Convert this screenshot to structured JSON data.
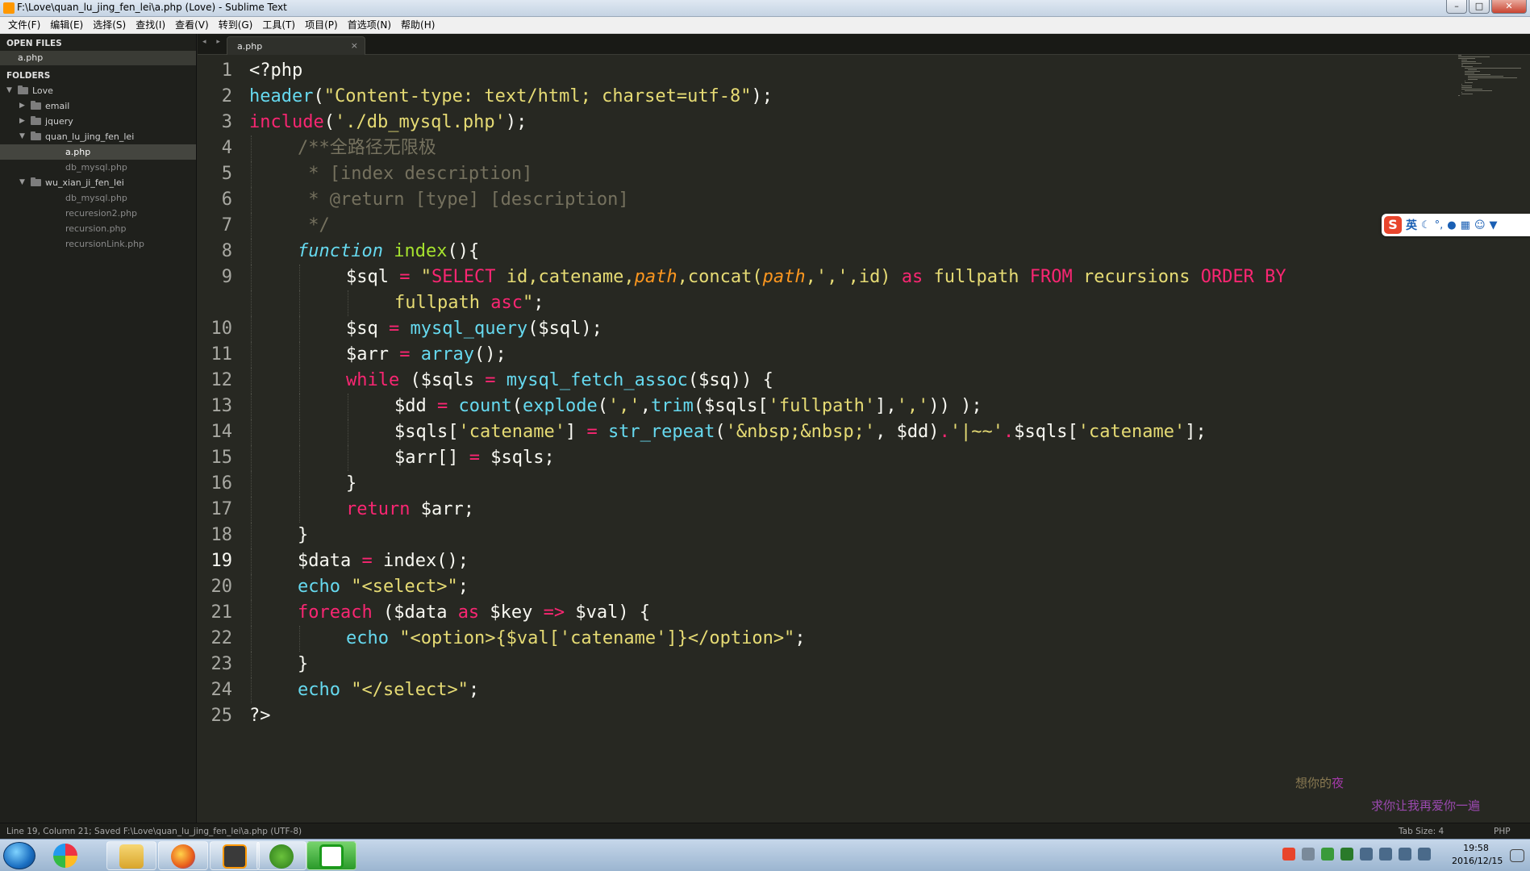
{
  "window": {
    "title": "F:\\Love\\quan_lu_jing_fen_lei\\a.php (Love) - Sublime Text",
    "buttons": [
      "–",
      "□",
      "✕"
    ]
  },
  "menu": [
    "文件(F)",
    "编辑(E)",
    "选择(S)",
    "查找(I)",
    "查看(V)",
    "转到(G)",
    "工具(T)",
    "项目(P)",
    "首选项(N)",
    "帮助(H)"
  ],
  "sidebar": {
    "open_files_title": "OPEN FILES",
    "open_files": [
      "a.php"
    ],
    "folders_title": "FOLDERS",
    "tree": [
      {
        "label": "Love",
        "type": "folder",
        "depth": 0,
        "expanded": true
      },
      {
        "label": "email",
        "type": "folder",
        "depth": 1,
        "expanded": false
      },
      {
        "label": "jquery",
        "type": "folder",
        "depth": 1,
        "expanded": false
      },
      {
        "label": "quan_lu_jing_fen_lei",
        "type": "folder",
        "depth": 1,
        "expanded": true
      },
      {
        "label": "a.php",
        "type": "file",
        "depth": 2,
        "selected": true
      },
      {
        "label": "db_mysql.php",
        "type": "file",
        "depth": 2
      },
      {
        "label": "wu_xian_ji_fen_lei",
        "type": "folder",
        "depth": 1,
        "expanded": true
      },
      {
        "label": "db_mysql.php",
        "type": "file",
        "depth": 2
      },
      {
        "label": "recuresion2.php",
        "type": "file",
        "depth": 2
      },
      {
        "label": "recursion.php",
        "type": "file",
        "depth": 2
      },
      {
        "label": "recursionLink.php",
        "type": "file",
        "depth": 2
      }
    ]
  },
  "tabs": {
    "nav": "◂ ▸",
    "items": [
      {
        "label": "a.php",
        "close": "×"
      }
    ]
  },
  "editor": {
    "current_line": 19,
    "lines": [
      {
        "n": "1",
        "indent": 0,
        "tokens": [
          [
            "<?php",
            ""
          ]
        ]
      },
      {
        "n": "2",
        "indent": 0,
        "tokens": [
          [
            "header",
            "fn"
          ],
          [
            "(",
            ""
          ],
          [
            "\"Content-type: text/html; charset=utf-8\"",
            "st"
          ],
          [
            ");",
            ""
          ]
        ]
      },
      {
        "n": "3",
        "indent": 0,
        "tokens": [
          [
            "include",
            "kw"
          ],
          [
            "(",
            ""
          ],
          [
            "'./db_mysql.php'",
            "st"
          ],
          [
            ");",
            ""
          ]
        ]
      },
      {
        "n": "4",
        "indent": 1,
        "tokens": [
          [
            "/**全路径无限极",
            "cm"
          ]
        ]
      },
      {
        "n": "5",
        "indent": 1,
        "tokens": [
          [
            " * [index description]",
            "cm"
          ]
        ]
      },
      {
        "n": "6",
        "indent": 1,
        "tokens": [
          [
            " * @return [type] [description]",
            "cm"
          ]
        ]
      },
      {
        "n": "7",
        "indent": 1,
        "tokens": [
          [
            " */",
            "cm"
          ]
        ]
      },
      {
        "n": "8",
        "indent": 1,
        "tokens": [
          [
            "function",
            "sto"
          ],
          [
            " ",
            ""
          ],
          [
            "index",
            "fnn"
          ],
          [
            "(){",
            ""
          ]
        ]
      },
      {
        "n": "9",
        "indent": 2,
        "tokens": [
          [
            "$sql ",
            ""
          ],
          [
            "=",
            "kw"
          ],
          [
            " ",
            ""
          ],
          [
            "\"",
            "st"
          ],
          [
            "SELECT",
            "kw"
          ],
          [
            " id,catename,",
            "st"
          ],
          [
            "path",
            "par"
          ],
          [
            ",concat(",
            "st"
          ],
          [
            "path",
            "par"
          ],
          [
            ",',',id) ",
            "st"
          ],
          [
            "as",
            "kw"
          ],
          [
            " fullpath ",
            "st"
          ],
          [
            "FROM",
            "kw"
          ],
          [
            " recursions ",
            "st"
          ],
          [
            "ORDER BY",
            "kw"
          ]
        ]
      },
      {
        "n": "",
        "indent": 3,
        "tokens": [
          [
            "fullpath ",
            "st"
          ],
          [
            "asc",
            "kw"
          ],
          [
            "\"",
            "st"
          ],
          [
            ";",
            ""
          ]
        ]
      },
      {
        "n": "10",
        "indent": 2,
        "tokens": [
          [
            "$sq ",
            ""
          ],
          [
            "=",
            "kw"
          ],
          [
            " ",
            ""
          ],
          [
            "mysql_query",
            "fn"
          ],
          [
            "($sql);",
            ""
          ]
        ]
      },
      {
        "n": "11",
        "indent": 2,
        "tokens": [
          [
            "$arr ",
            ""
          ],
          [
            "=",
            "kw"
          ],
          [
            " ",
            ""
          ],
          [
            "array",
            "fn"
          ],
          [
            "();",
            ""
          ]
        ]
      },
      {
        "n": "12",
        "indent": 2,
        "tokens": [
          [
            "while",
            "kw"
          ],
          [
            " ($sqls ",
            ""
          ],
          [
            "=",
            "kw"
          ],
          [
            " ",
            ""
          ],
          [
            "mysql_fetch_assoc",
            "fn"
          ],
          [
            "($sq)) {",
            ""
          ]
        ]
      },
      {
        "n": "13",
        "indent": 3,
        "tokens": [
          [
            "$dd ",
            ""
          ],
          [
            "=",
            "kw"
          ],
          [
            " ",
            ""
          ],
          [
            "count",
            "fn"
          ],
          [
            "(",
            ""
          ],
          [
            "explode",
            "fn"
          ],
          [
            "(",
            ""
          ],
          [
            "','",
            "st"
          ],
          [
            ",",
            ""
          ],
          [
            "trim",
            "fn"
          ],
          [
            "($sqls[",
            ""
          ],
          [
            "'fullpath'",
            "st"
          ],
          [
            "],",
            ""
          ],
          [
            "','",
            "st"
          ],
          [
            ")) );",
            ""
          ]
        ]
      },
      {
        "n": "14",
        "indent": 3,
        "tokens": [
          [
            "$sqls[",
            ""
          ],
          [
            "'catename'",
            "st"
          ],
          [
            "] ",
            ""
          ],
          [
            "=",
            "kw"
          ],
          [
            " ",
            ""
          ],
          [
            "str_repeat",
            "fn"
          ],
          [
            "(",
            ""
          ],
          [
            "'&nbsp;&nbsp;'",
            "st"
          ],
          [
            ", $dd)",
            ""
          ],
          [
            ".",
            "kw"
          ],
          [
            "'|~~'",
            "st"
          ],
          [
            ".",
            "kw"
          ],
          [
            "$sqls[",
            ""
          ],
          [
            "'catename'",
            "st"
          ],
          [
            "];",
            ""
          ]
        ]
      },
      {
        "n": "15",
        "indent": 3,
        "tokens": [
          [
            "$arr[] ",
            ""
          ],
          [
            "=",
            "kw"
          ],
          [
            " $sqls;",
            ""
          ]
        ]
      },
      {
        "n": "16",
        "indent": 2,
        "tokens": [
          [
            "}",
            ""
          ]
        ]
      },
      {
        "n": "17",
        "indent": 2,
        "tokens": [
          [
            "return",
            "kw"
          ],
          [
            " $arr;",
            ""
          ]
        ]
      },
      {
        "n": "18",
        "indent": 1,
        "tokens": [
          [
            "}",
            ""
          ]
        ]
      },
      {
        "n": "19",
        "indent": 1,
        "tokens": [
          [
            "$data ",
            ""
          ],
          [
            "=",
            "kw"
          ],
          [
            " index();",
            ""
          ]
        ]
      },
      {
        "n": "20",
        "indent": 1,
        "tokens": [
          [
            "echo",
            "fn"
          ],
          [
            " ",
            ""
          ],
          [
            "\"<select>\"",
            "st"
          ],
          [
            ";",
            ""
          ]
        ]
      },
      {
        "n": "21",
        "indent": 1,
        "tokens": [
          [
            "foreach",
            "kw"
          ],
          [
            " ($data ",
            ""
          ],
          [
            "as",
            "kw"
          ],
          [
            " $key ",
            ""
          ],
          [
            "=>",
            "kw"
          ],
          [
            " $val) {",
            ""
          ]
        ]
      },
      {
        "n": "22",
        "indent": 2,
        "tokens": [
          [
            "echo",
            "fn"
          ],
          [
            " ",
            ""
          ],
          [
            "\"<option>{$val['catename']}</option>\"",
            "st"
          ],
          [
            ";",
            ""
          ]
        ]
      },
      {
        "n": "23",
        "indent": 1,
        "tokens": [
          [
            "}",
            ""
          ]
        ]
      },
      {
        "n": "24",
        "indent": 1,
        "tokens": [
          [
            "echo",
            "fn"
          ],
          [
            " ",
            ""
          ],
          [
            "\"</select>\"",
            "st"
          ],
          [
            ";",
            ""
          ]
        ]
      },
      {
        "n": "25",
        "indent": 0,
        "tokens": [
          [
            "?>",
            ""
          ]
        ]
      }
    ]
  },
  "ime": {
    "logo": "S",
    "lang": "英",
    "icons": [
      "moon-icon",
      "comma-icon",
      "mic-icon",
      "keyboard-icon",
      "user-icon",
      "shirt-icon"
    ]
  },
  "overlay": {
    "line1_a": "想你的",
    "line1_b": "夜",
    "line2": "求你让我再爱你一遍"
  },
  "status": {
    "left": "Line 19, Column 21; Saved F:\\Love\\quan_lu_jing_fen_lei\\a.php (UTF-8)",
    "tab_size": "Tab Size: 4",
    "syntax": "PHP"
  },
  "taskbar": {
    "apps": [
      "explorer-icon",
      "firefox-icon",
      "sublime-icon",
      "app-green-icon",
      "app-active-icon"
    ],
    "time": "19:58",
    "date": "2016/12/15"
  },
  "colors": {
    "bg": "#272822",
    "keyword": "#f92672",
    "function": "#66d9ef",
    "entity": "#a6e22e",
    "string": "#e6db74",
    "comment": "#75715e"
  }
}
